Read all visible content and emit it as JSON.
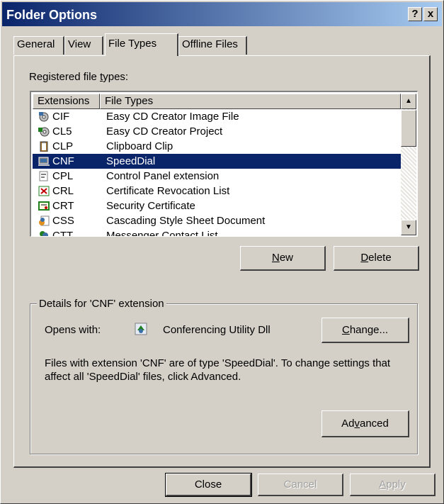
{
  "window": {
    "title": "Folder Options",
    "help_label": "?",
    "close_label": "x"
  },
  "tabs": [
    {
      "label": "General"
    },
    {
      "label": "View"
    },
    {
      "label": "File Types"
    },
    {
      "label": "Offline Files"
    }
  ],
  "registered": {
    "label_pre": "Registered file ",
    "label_u": "t",
    "label_post": "ypes:",
    "columns": [
      "Extensions",
      "File Types"
    ],
    "rows": [
      {
        "ext": "CIF",
        "type": "Easy CD Creator Image File",
        "icon": "cd-image-icon"
      },
      {
        "ext": "CL5",
        "type": "Easy CD Creator Project",
        "icon": "cd-project-icon"
      },
      {
        "ext": "CLP",
        "type": "Clipboard Clip",
        "icon": "clipboard-icon"
      },
      {
        "ext": "CNF",
        "type": "SpeedDial",
        "icon": "speeddial-icon",
        "selected": true
      },
      {
        "ext": "CPL",
        "type": "Control Panel extension",
        "icon": "control-panel-icon"
      },
      {
        "ext": "CRL",
        "type": "Certificate Revocation List",
        "icon": "certificate-revocation-icon"
      },
      {
        "ext": "CRT",
        "type": "Security Certificate",
        "icon": "security-certificate-icon"
      },
      {
        "ext": "CSS",
        "type": "Cascading Style Sheet Document",
        "icon": "stylesheet-icon"
      },
      {
        "ext": "CTT",
        "type": "Messenger Contact List",
        "icon": "contact-list-icon"
      }
    ]
  },
  "buttons": {
    "new_u": "N",
    "new_rest": "ew",
    "delete_u": "D",
    "delete_rest": "elete",
    "change_u": "C",
    "change_rest": "hange...",
    "advanced_pre": "Ad",
    "advanced_u": "v",
    "advanced_post": "anced",
    "close": "Close",
    "cancel": "Cancel",
    "apply_u": "A",
    "apply_rest": "pply"
  },
  "details": {
    "group_label": "Details for 'CNF' extension",
    "opens_with_label": "Opens with:",
    "opens_with_app": "Conferencing Utility Dll",
    "description": "Files with extension 'CNF' are of type 'SpeedDial'.  To change settings that affect all 'SpeedDial' files, click Advanced."
  },
  "colors": {
    "selection": "#0a246a",
    "face": "#d4d0c8",
    "title_start": "#0a246a",
    "title_end": "#a6caf0"
  }
}
